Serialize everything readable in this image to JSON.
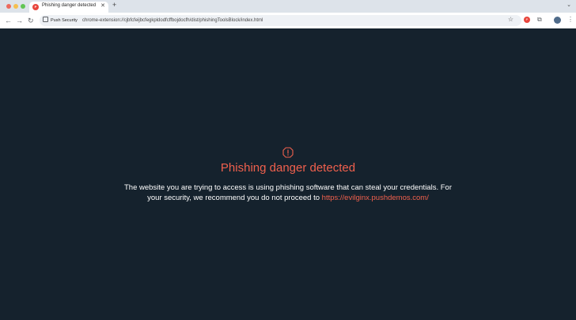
{
  "browser": {
    "tab": {
      "title": "Phishing danger detected",
      "favicon": "push-security-favicon"
    },
    "new_tab_glyph": "+",
    "site_chip": "Push Security",
    "url": "chrome-extension://cjbfcfeijbcfegkpldodfcffbojdocfh/dist/phishingToolsBlock/index.html"
  },
  "page": {
    "heading": "Phishing danger detected",
    "message_before": "The website you are trying to access is using phishing software that can steal your credentials. For your security, we recommend you do not proceed to ",
    "blocked_url": "https://evilginx.pushdemos.com/"
  },
  "colors": {
    "background": "#15222d",
    "accent": "#f0604d",
    "text": "#ffffff"
  }
}
